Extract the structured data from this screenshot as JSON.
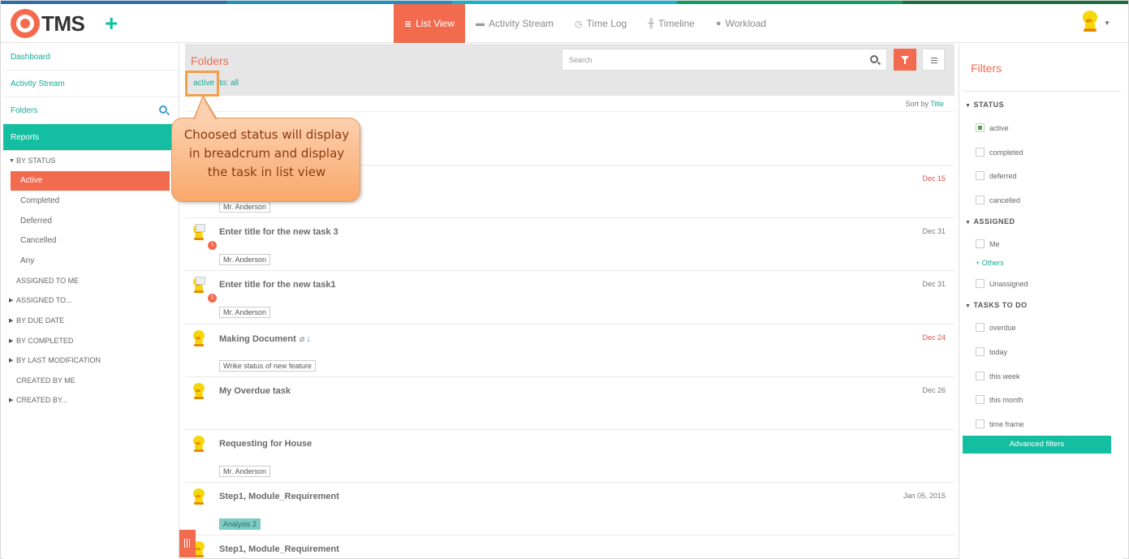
{
  "colors": {
    "accent": "#f36b4f",
    "teal": "#14bfa1",
    "link": "#14a996"
  },
  "top_strip_colors": [
    "#2b6cb0",
    "#1e8fc4",
    "#0fb4d0",
    "#0e9f5a",
    "#1a6e3a"
  ],
  "header": {
    "logo_text": "TMS",
    "add_icon": "plus-icon",
    "nav": [
      {
        "label": "List View",
        "icon": "list-icon",
        "icon_glyph": "≣",
        "active": true
      },
      {
        "label": "Activity Stream",
        "icon": "comment-icon",
        "icon_glyph": "▬",
        "active": false
      },
      {
        "label": "Time Log",
        "icon": "clock-icon",
        "icon_glyph": "◷",
        "active": false
      },
      {
        "label": "Timeline",
        "icon": "sliders-icon",
        "icon_glyph": "╫",
        "active": false
      },
      {
        "label": "Workload",
        "icon": "user-icon",
        "icon_glyph": "●",
        "active": false
      }
    ]
  },
  "sidebar": {
    "links": {
      "dashboard": "Dashboard",
      "activity_stream": "Activity Stream",
      "folders": "Folders",
      "reports": "Reports"
    },
    "by_status": "BY STATUS",
    "status_items": [
      "Active",
      "Completed",
      "Deferred",
      "Cancelled",
      "Any"
    ],
    "groups": {
      "assigned_to_me": "ASSIGNED TO ME",
      "assigned_to": "ASSIGNED TO...",
      "by_due_date": "BY DUE DATE",
      "by_completed": "BY COMPLETED",
      "by_last_modification": "BY LAST MODIFICATION",
      "created_by_me": "CREATED BY ME",
      "created_by": "CREATED BY..."
    }
  },
  "main": {
    "title": "Folders",
    "search_placeholder": "Search",
    "breadcrumb": {
      "active": "active",
      "to": "to: all"
    },
    "sort": {
      "label": "Sort by",
      "value": "Title"
    },
    "tasks": [
      {
        "title": "",
        "date": "",
        "date_red": false,
        "tag": ""
      },
      {
        "title": "",
        "date": "Dec 15",
        "date_red": true,
        "tag": "Mr. Anderson"
      },
      {
        "title": "Enter title for the new task 3",
        "date": "Dec 31",
        "date_red": false,
        "tag": "Mr. Anderson",
        "badge": "1"
      },
      {
        "title": "Enter title for the new task1",
        "date": "Dec 31",
        "date_red": false,
        "tag": "Mr. Anderson",
        "badge": "1"
      },
      {
        "title": "Making Document",
        "date": "Dec 24",
        "date_red": true,
        "tag": "Wrike status of new feature"
      },
      {
        "title": "My Overdue task",
        "date": "Dec 26",
        "date_red": false,
        "tag": ""
      },
      {
        "title": "Requesting for House",
        "date": "",
        "date_red": false,
        "tag": "Mr. Anderson"
      },
      {
        "title": "Step1, Module_Requirement",
        "date": "Jan 05, 2015",
        "date_red": false,
        "tag": "Analysis 2"
      },
      {
        "title": "Step1, Module_Requirement",
        "date": "",
        "date_red": false,
        "tag": ""
      }
    ]
  },
  "filters": {
    "title": "Filters",
    "status_label": "STATUS",
    "status": [
      {
        "label": "active",
        "checked": true
      },
      {
        "label": "completed",
        "checked": false
      },
      {
        "label": "deferred",
        "checked": false
      },
      {
        "label": "cancelled",
        "checked": false
      }
    ],
    "assigned_label": "ASSIGNED",
    "assigned": {
      "me": "Me",
      "others": "+ Others",
      "unassigned": "Unassigned"
    },
    "todo_label": "TASKS TO DO",
    "todo": [
      "overdue",
      "today",
      "this week",
      "this month",
      "time frame"
    ],
    "advanced": "Advanced filters"
  },
  "callout": {
    "text": "Choosed status will display in breadcrum and display the task in list view"
  }
}
